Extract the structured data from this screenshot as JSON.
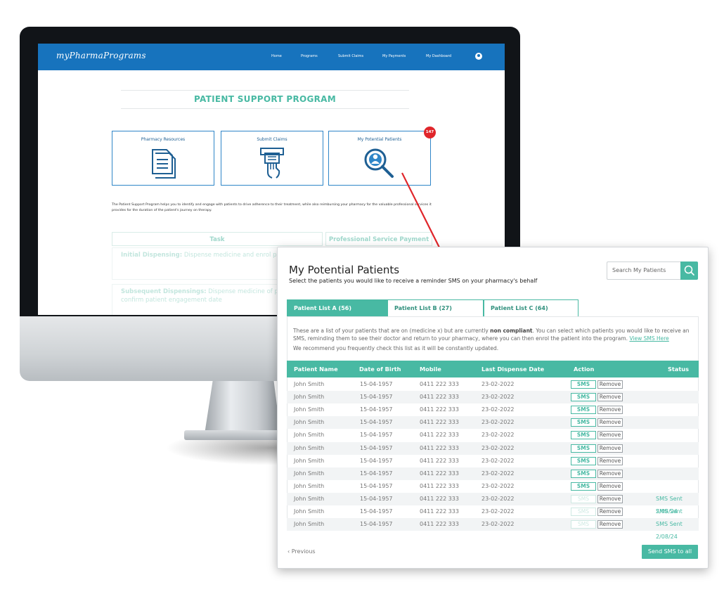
{
  "screen": {
    "brand": "myPharmaPrograms",
    "nav": [
      "Home",
      "Programs",
      "Submit Claims",
      "My Payments",
      "My Dashboard"
    ],
    "program_title": "PATIENT SUPPORT PROGRAM",
    "cards": [
      {
        "label": "Pharmacy Resources",
        "icon": "document-icon"
      },
      {
        "label": "Submit Claims",
        "icon": "claim-hand-icon"
      },
      {
        "label": "My Potential Patients",
        "icon": "patient-search-icon"
      }
    ],
    "badge_count": "147",
    "description": "The Patient Support Program helps you to identify and engage with patients to drive adherence to their treatment, while also reimbursing your pharmacy for the valuable professional services it provides for the duration of the patient's journey on therapy.",
    "task_header": "Task",
    "payment_header": "Professional Service Payment",
    "task_rows": [
      {
        "bold": "Initial Dispensing:",
        "text": " Dispense medicine and enrol pa program"
      },
      {
        "bold": "Subsequent Dispensings:",
        "text": " Dispense medicine of patient and confirm patient engagement date"
      }
    ]
  },
  "popup": {
    "title": "My Potential Patients",
    "subtitle": "Select the patients you would like to receive a reminder SMS on your pharmacy's behalf",
    "search_placeholder": "Search My Patients",
    "tabs": [
      "Patient List A (56)",
      "Patient List B (27)",
      "Patient List C (64)"
    ],
    "info_part1": "These are a list of your patients that are on (medicine x) but are currently ",
    "info_bold": "non compliant",
    "info_part2": ". You can select which patients you would like to receive an SMS, reminding them to see their doctor and return to your pharmacy, where you can then enrol the patient into the program. ",
    "info_link": "View SMS Here",
    "info_line2": "We recommend you frequently check this list as it will be constantly updated.",
    "columns": [
      "Patient Name",
      "Date of Birth",
      "Mobile",
      "Last Dispense Date",
      "Action",
      "Status"
    ],
    "sms_label": "SMS",
    "remove_label": "Remove",
    "rows": [
      {
        "name": "John Smith",
        "dob": "15-04-1957",
        "mobile": "0411 222 333",
        "last": "23-02-2022",
        "status": "",
        "sent": false
      },
      {
        "name": "John Smith",
        "dob": "15-04-1957",
        "mobile": "0411 222 333",
        "last": "23-02-2022",
        "status": "",
        "sent": false
      },
      {
        "name": "John Smith",
        "dob": "15-04-1957",
        "mobile": "0411 222 333",
        "last": "23-02-2022",
        "status": "",
        "sent": false
      },
      {
        "name": "John Smith",
        "dob": "15-04-1957",
        "mobile": "0411 222 333",
        "last": "23-02-2022",
        "status": "",
        "sent": false
      },
      {
        "name": "John Smith",
        "dob": "15-04-1957",
        "mobile": "0411 222 333",
        "last": "23-02-2022",
        "status": "",
        "sent": false
      },
      {
        "name": "John Smith",
        "dob": "15-04-1957",
        "mobile": "0411 222 333",
        "last": "23-02-2022",
        "status": "",
        "sent": false
      },
      {
        "name": "John Smith",
        "dob": "15-04-1957",
        "mobile": "0411 222 333",
        "last": "23-02-2022",
        "status": "",
        "sent": false
      },
      {
        "name": "John Smith",
        "dob": "15-04-1957",
        "mobile": "0411 222 333",
        "last": "23-02-2022",
        "status": "",
        "sent": false
      },
      {
        "name": "John Smith",
        "dob": "15-04-1957",
        "mobile": "0411 222 333",
        "last": "23-02-2022",
        "status": "",
        "sent": false
      },
      {
        "name": "John Smith",
        "dob": "15-04-1957",
        "mobile": "0411 222 333",
        "last": "23-02-2022",
        "status": "SMS Sent 2/08/24",
        "sent": true
      },
      {
        "name": "John Smith",
        "dob": "15-04-1957",
        "mobile": "0411 222 333",
        "last": "23-02-2022",
        "status": "SMS Sent 2/08/24",
        "sent": true
      },
      {
        "name": "John Smith",
        "dob": "15-04-1957",
        "mobile": "0411 222 333",
        "last": "23-02-2022",
        "status": "SMS Sent 2/08/24",
        "sent": true
      }
    ],
    "previous_label": "Previous",
    "send_all_label": "Send SMS to all"
  },
  "colors": {
    "brand_blue": "#1773bd",
    "accent_teal": "#48b9a3",
    "badge_red": "#e0262b",
    "arrow_red": "#e0262b"
  }
}
